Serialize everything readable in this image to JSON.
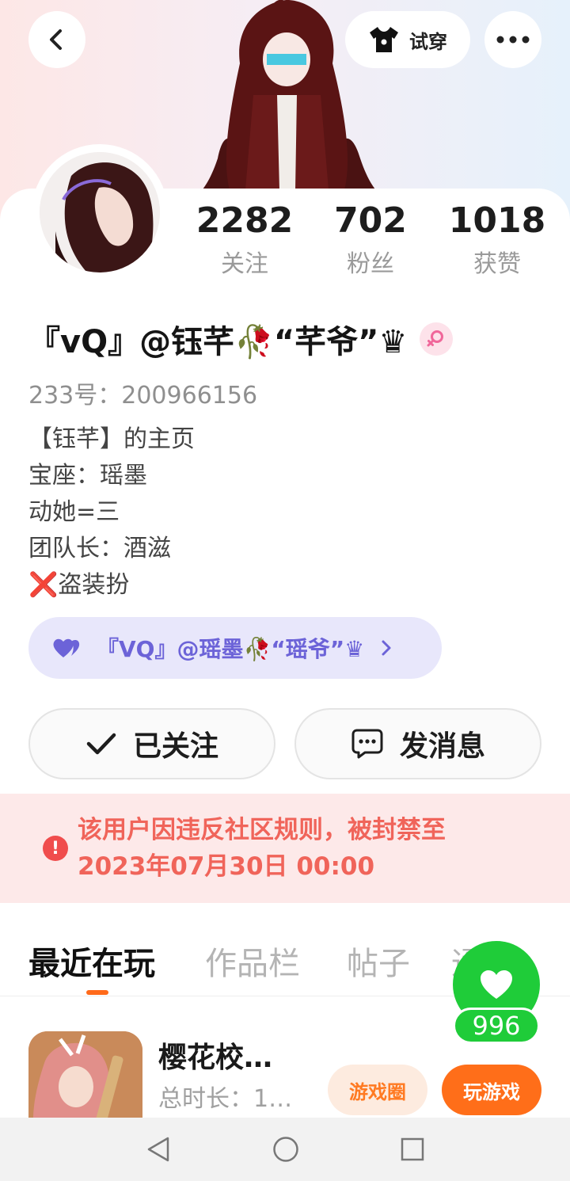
{
  "header": {
    "tryon_label": "试穿"
  },
  "stats": [
    {
      "value": "2282",
      "label": "关注"
    },
    {
      "value": "702",
      "label": "粉丝"
    },
    {
      "value": "1018",
      "label": "获赞"
    }
  ],
  "profile": {
    "name": "『vQ』@钰芊🥀“芊爷”♛",
    "uid": "233号：200966156",
    "bio": [
      "【钰芊】的主页",
      "宝座：瑶墨",
      "动她=三",
      "团队长：酒滋",
      "❌盗装扮"
    ]
  },
  "partner": {
    "name": "『VQ』@瑶墨🥀“瑶爷”♛"
  },
  "actions": {
    "follow_label": "已关注",
    "message_label": "发消息"
  },
  "ban_notice": {
    "line1": "该用户因违反社区规则，被封禁至",
    "line2": "2023年07月30日 00:00"
  },
  "tabs": [
    "最近在玩",
    "作品栏",
    "帖子",
    "通"
  ],
  "game": {
    "title": "樱花校…",
    "time": "总时长：1…",
    "circle_label": "游戏圈",
    "play_label": "玩游戏"
  },
  "like": {
    "count": "996"
  },
  "colors": {
    "accent": "#ff6e19",
    "ban_text": "#f0645a",
    "like_green": "#1fcc39",
    "partner_purple": "#6c63d8"
  }
}
